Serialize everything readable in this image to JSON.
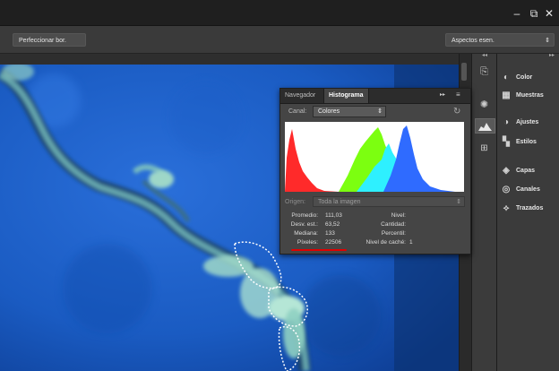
{
  "window": {
    "minimize_glyph": "–",
    "restore_glyph": "⧉",
    "close_glyph": "✕"
  },
  "options_bar": {
    "refine_button": "Perfeccionar bor.",
    "workspace_select": "Aspectos esen.",
    "workspace_arrow": "⇕"
  },
  "right_panels": {
    "items": [
      {
        "label": "Color",
        "icon": "color-icon"
      },
      {
        "label": "Muestras",
        "icon": "swatches-icon"
      },
      {
        "label": "Ajustes",
        "icon": "adjustments-icon"
      },
      {
        "label": "Estilos",
        "icon": "styles-icon"
      },
      {
        "label": "Capas",
        "icon": "layers-icon"
      },
      {
        "label": "Canales",
        "icon": "channels-icon"
      },
      {
        "label": "Trazados",
        "icon": "paths-icon"
      }
    ]
  },
  "histogram_panel": {
    "tabs": [
      "Navegador",
      "Histograma"
    ],
    "active_tab": "Histograma",
    "menu_glyph": "▸▸",
    "channel_label": "Canal:",
    "channel_value": "Colores",
    "source_label": "Origen:",
    "source_value": "Toda la imagen",
    "stats_left": [
      {
        "label": "Promedio:",
        "value": "111,03"
      },
      {
        "label": "Desv. est.:",
        "value": "63,52"
      },
      {
        "label": "Mediana:",
        "value": "133"
      },
      {
        "label": "Píxeles:",
        "value": "22506"
      }
    ],
    "stats_right": [
      {
        "label": "Nivel:",
        "value": ""
      },
      {
        "label": "Cantidad:",
        "value": ""
      },
      {
        "label": "Percentil:",
        "value": ""
      },
      {
        "label": "Nivel de caché:",
        "value": "1"
      }
    ],
    "colors": {
      "red": "#ff2a2a",
      "green": "#7cff10",
      "cyan": "#2ef0ff",
      "blue": "#2f6bff",
      "underline": "#e00000"
    }
  }
}
